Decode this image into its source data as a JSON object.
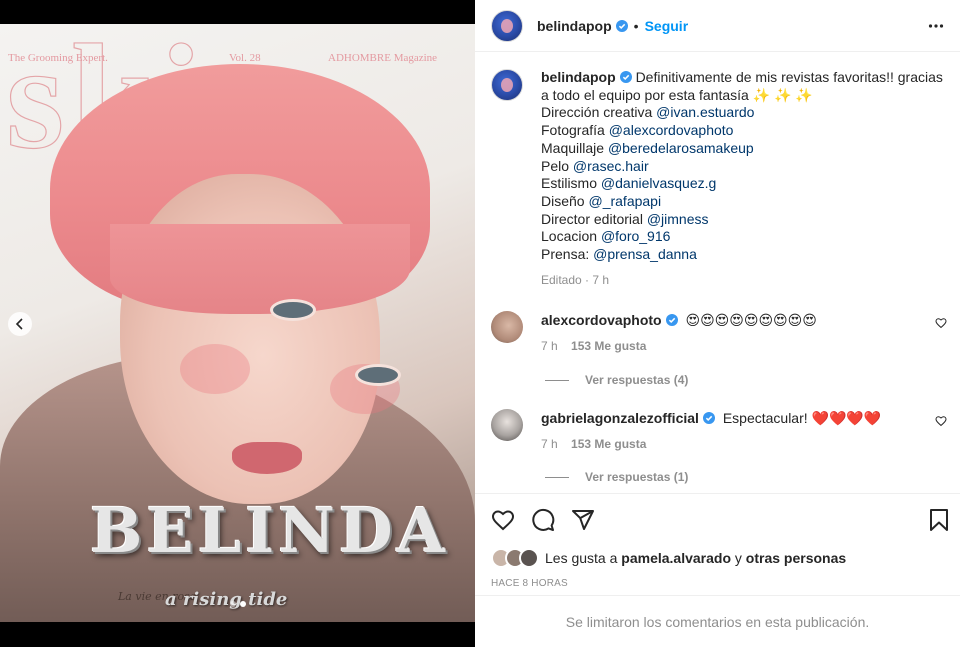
{
  "media": {
    "magazine_left": "The Grooming Expert.",
    "magazine_vol": "Vol. 28",
    "magazine_right": "ADHOMBRE Magazine",
    "masthead": "skin",
    "cover_logo": "BELINDA",
    "tagline": "a rising tide",
    "tagline_small": "La vie en rose",
    "carousel": {
      "current": 2,
      "total": 2
    }
  },
  "post": {
    "username": "belindapop",
    "follow_label": "Seguir",
    "separator": "•",
    "caption": {
      "username": "belindapop",
      "first_line": "Definitivamente de mis revistas favoritas!! gracias a todo el equipo por esta fantasía ✨ ✨ ✨",
      "credits": [
        {
          "role": "Dirección creativa",
          "handle": "@ivan.estuardo"
        },
        {
          "role": "Fotografía",
          "handle": "@alexcordovaphoto"
        },
        {
          "role": "Maquillaje",
          "handle": "@beredelarosamakeup"
        },
        {
          "role": "Pelo",
          "handle": "@rasec.hair"
        },
        {
          "role": "Estilismo",
          "handle": "@danielvasquez.g"
        },
        {
          "role": "Diseño",
          "handle": "@_rafapapi"
        },
        {
          "role": "Director editorial",
          "handle": "@jimness"
        },
        {
          "role": "Locacion",
          "handle": "@foro_916"
        },
        {
          "role": "Prensa:",
          "handle": "@prensa_danna"
        }
      ],
      "meta": "Editado · 7 h"
    },
    "comments": [
      {
        "username": "alexcordovaphoto",
        "text": "😍😍😍😍😍😍😍😍😍",
        "time": "7 h",
        "likes": "153 Me gusta",
        "replies": "Ver respuestas (4)"
      },
      {
        "username": "gabrielagonzalezofficial",
        "text": "Espectacular! ❤️❤️❤️❤️",
        "time": "7 h",
        "likes": "153 Me gusta",
        "replies": "Ver respuestas (1)"
      }
    ],
    "likes_prefix": "Les gusta a",
    "likes_user": "pamela.alvarado",
    "likes_and": "y",
    "likes_others": "otras personas",
    "posted_time": "HACE 8 HORAS",
    "comments_limited": "Se limitaron los comentarios en esta publicación."
  },
  "icons": {
    "verified": "verified-badge-icon",
    "more": "more-options-icon",
    "like": "heart-icon",
    "comment": "comment-icon",
    "share": "share-icon",
    "save": "bookmark-icon",
    "prev": "chevron-left-icon"
  },
  "colors": {
    "accent": "#0095f6",
    "mention": "#00376b",
    "muted": "#8e8e8e",
    "verified": "#3897f0"
  }
}
